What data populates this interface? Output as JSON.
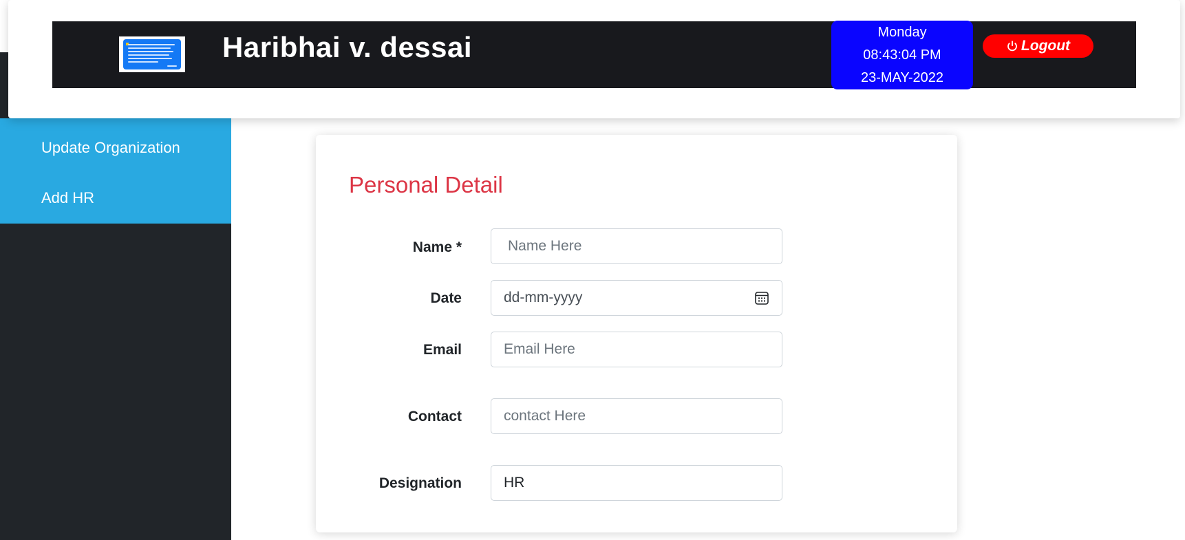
{
  "header": {
    "title": "Haribhai v. dessai",
    "logo_icon": "app-logo",
    "datetime": {
      "day": "Monday",
      "time": "08:43:04 PM",
      "date": "23-MAY-2022"
    },
    "logout_label": "Logout",
    "logout_icon": "power-icon"
  },
  "sidebar": {
    "items": [
      {
        "label": "Update Organization"
      },
      {
        "label": "Add HR"
      }
    ]
  },
  "form": {
    "section_title": "Personal Detail",
    "fields": [
      {
        "label": "Name *",
        "placeholder": "Name Here",
        "value": ""
      },
      {
        "label": "Date",
        "placeholder": "dd-mm-yyyy",
        "value": ""
      },
      {
        "label": "Email",
        "placeholder": "Email Here",
        "value": ""
      },
      {
        "label": "Contact",
        "placeholder": "contact Here",
        "value": ""
      },
      {
        "label": "Designation",
        "placeholder": "",
        "value": "HR"
      }
    ],
    "calendar_icon": "calendar-icon"
  },
  "colors": {
    "header_bg": "#18191d",
    "datetime_bg": "#0a05ff",
    "logout_bg": "#ff0000",
    "sidebar_bg": "#212529",
    "menu_bg": "#29a9e1",
    "section_title": "#dc3545"
  }
}
